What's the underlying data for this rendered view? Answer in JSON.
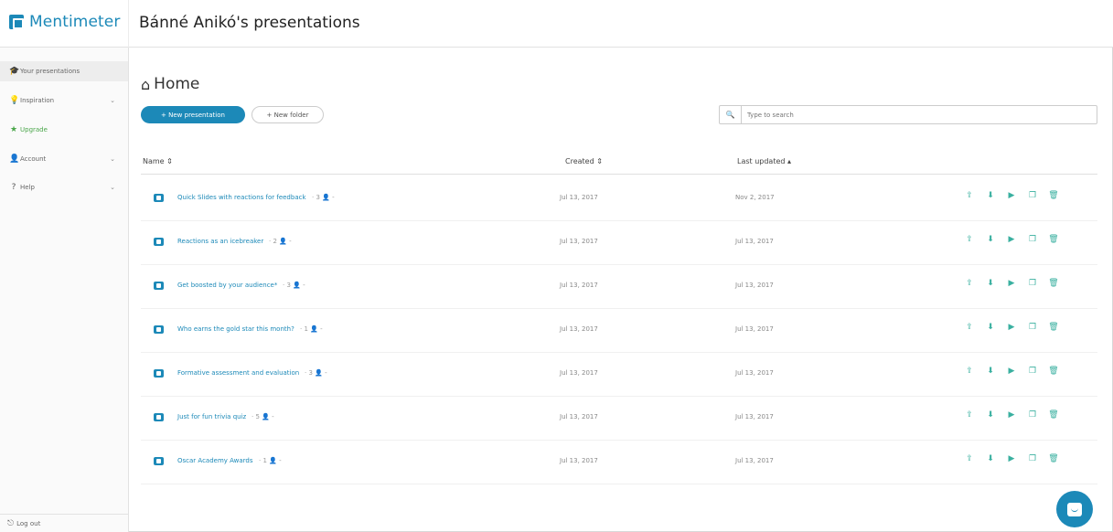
{
  "app": {
    "logo_text": "Mentimeter",
    "page_heading": "Bánné Anikó's presentations",
    "accent_color": "#1c89b8"
  },
  "sidebar": {
    "items": [
      {
        "label": "Your presentations",
        "icon": "graduation-cap-icon",
        "active": true
      },
      {
        "label": "Inspiration",
        "icon": "lightbulb-icon",
        "chevron": "⌄"
      },
      {
        "label": "Upgrade",
        "icon": "star-icon"
      },
      {
        "label": "Account",
        "icon": "user-icon",
        "chevron": "⌄"
      },
      {
        "label": "Help",
        "icon": "question-icon",
        "chevron": "⌄"
      }
    ],
    "logout_label": "Log out"
  },
  "main": {
    "home_title": "Home",
    "new_presentation_label": "+ New presentation",
    "new_folder_label": "+ New folder",
    "search_placeholder": "Type to search",
    "columns": {
      "name": "Name ⇕",
      "created": "Created ⇕",
      "last_updated": "Last updated ▴"
    },
    "rows": [
      {
        "title": "Quick Slides with reactions for feedback",
        "meta": "· 3 👤 -",
        "created": "Jul 13, 2017",
        "updated": "Nov 2, 2017"
      },
      {
        "title": "Reactions as an icebreaker",
        "meta": "· 2 👤 -",
        "created": "Jul 13, 2017",
        "updated": "Jul 13, 2017"
      },
      {
        "title": "Get boosted by your audience*",
        "meta": "· 3 👤 -",
        "created": "Jul 13, 2017",
        "updated": "Jul 13, 2017"
      },
      {
        "title": "Who earns the gold star this month?",
        "meta": "· 1 👤 -",
        "created": "Jul 13, 2017",
        "updated": "Jul 13, 2017"
      },
      {
        "title": "Formative assessment and evaluation",
        "meta": "· 3 👤 -",
        "created": "Jul 13, 2017",
        "updated": "Jul 13, 2017"
      },
      {
        "title": "Just for fun trivia quiz",
        "meta": "· 5 👤 -",
        "created": "Jul 13, 2017",
        "updated": "Jul 13, 2017"
      },
      {
        "title": "Oscar Academy Awards",
        "meta": "· 1 👤 -",
        "created": "Jul 13, 2017",
        "updated": "Jul 13, 2017"
      }
    ],
    "row_actions": [
      "share-icon",
      "download-icon",
      "move-to-folder-icon",
      "duplicate-icon",
      "delete-icon"
    ]
  }
}
